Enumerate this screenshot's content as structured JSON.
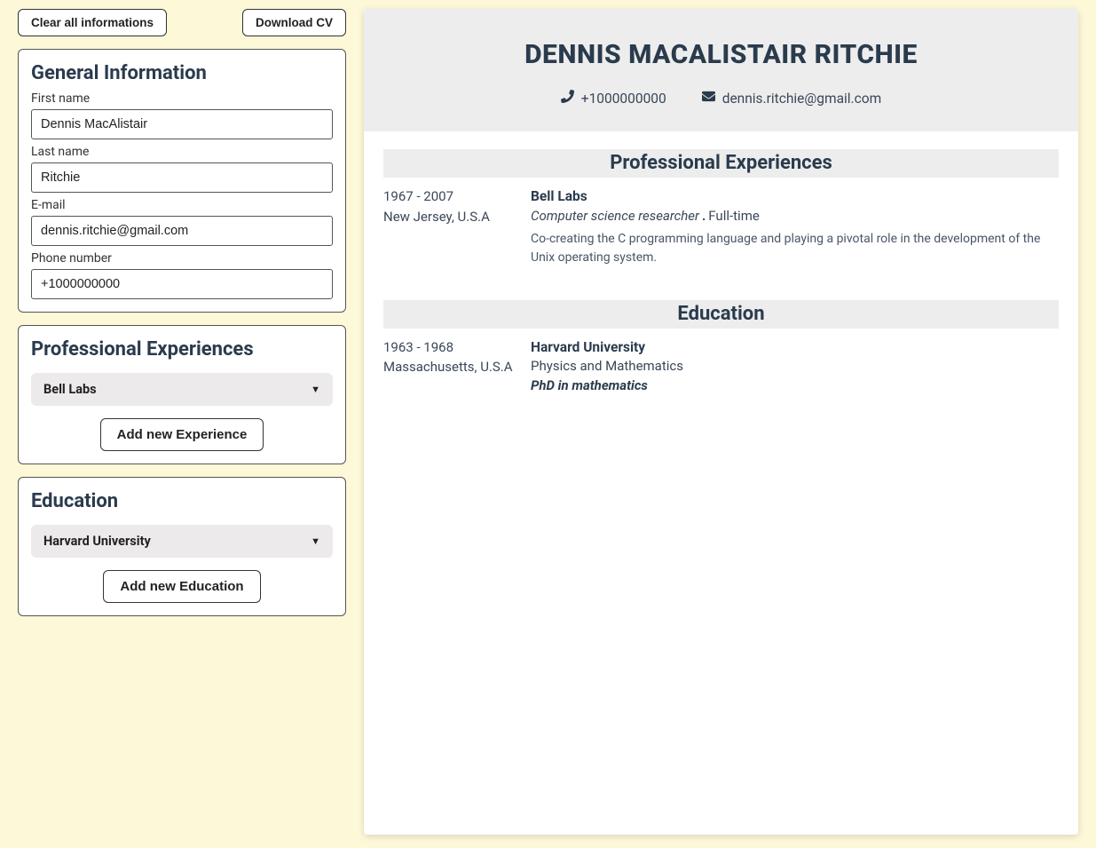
{
  "actions": {
    "clear_label": "Clear all informations",
    "download_label": "Download CV"
  },
  "panels": {
    "general": {
      "title": "General Information",
      "first_name_label": "First name",
      "first_name_value": "Dennis MacAlistair",
      "last_name_label": "Last name",
      "last_name_value": "Ritchie",
      "email_label": "E-mail",
      "email_value": "dennis.ritchie@gmail.com",
      "phone_label": "Phone number",
      "phone_value": "+1000000000"
    },
    "experiences": {
      "title": "Professional Experiences",
      "items": [
        {
          "label": "Bell Labs"
        }
      ],
      "add_label": "Add new Experience"
    },
    "education": {
      "title": "Education",
      "items": [
        {
          "label": "Harvard University"
        }
      ],
      "add_label": "Add new Education"
    }
  },
  "preview": {
    "full_name": "DENNIS MACALISTAIR RITCHIE",
    "phone": "+1000000000",
    "email": "dennis.ritchie@gmail.com",
    "sections": {
      "experiences_title": "Professional Experiences",
      "education_title": "Education"
    },
    "experiences": [
      {
        "period": "1967 - 2007",
        "location": "New Jersey, U.S.A",
        "org": "Bell Labs",
        "role": "Computer science researcher",
        "type": "Full-time",
        "desc": "Co-creating the C programming language and playing a pivotal role in the development of the Unix operating system."
      }
    ],
    "education": [
      {
        "period": "1963 - 1968",
        "location": "Massachusetts, U.S.A",
        "org": "Harvard University",
        "field": "Physics and Mathematics",
        "degree": "PhD in mathematics"
      }
    ]
  }
}
